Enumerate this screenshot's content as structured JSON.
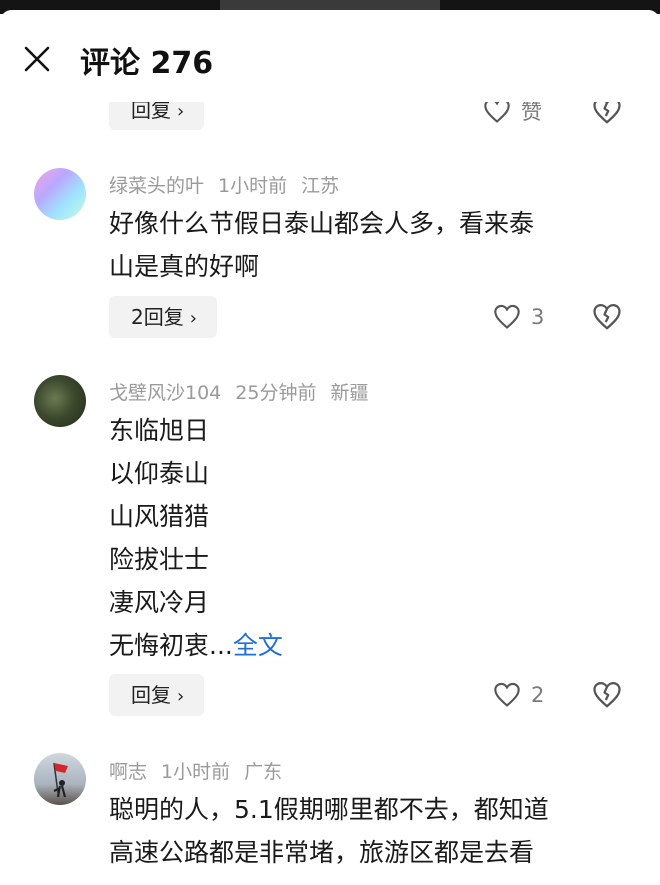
{
  "header": {
    "title": "评论 276",
    "close_icon": "close-icon"
  },
  "top_partial": {
    "reply_label": "回复",
    "like_label": "赞"
  },
  "comments": [
    {
      "username": "绿菜头的叶",
      "time": "1小时前",
      "location": "江苏",
      "lines": [
        "好像什么节假日泰山都会人多，看来泰",
        "山是真的好啊"
      ],
      "reply_label": "2回复",
      "likes": "3"
    },
    {
      "username": "戈壁风沙104",
      "time": "25分钟前",
      "location": "新疆",
      "lines": [
        "东临旭日",
        "以仰泰山",
        "山风猎猎",
        "险拔壮士",
        "凄风冷月",
        "无悔初衷..."
      ],
      "more_label": "全文",
      "reply_label": "回复",
      "likes": "2"
    },
    {
      "username": "啊志",
      "time": "1小时前",
      "location": "广东",
      "lines": [
        "聪明的人，5.1假期哪里都不去，都知道",
        "高速公路都是非常堵，旅游区都是去看"
      ]
    }
  ],
  "colors": {
    "accent": "#1f6fd6",
    "meta": "#9a9a9a",
    "button_bg": "#f2f2f2"
  },
  "icons": [
    "close-icon",
    "heart-icon",
    "broken-heart-icon",
    "chevron-right-icon"
  ]
}
